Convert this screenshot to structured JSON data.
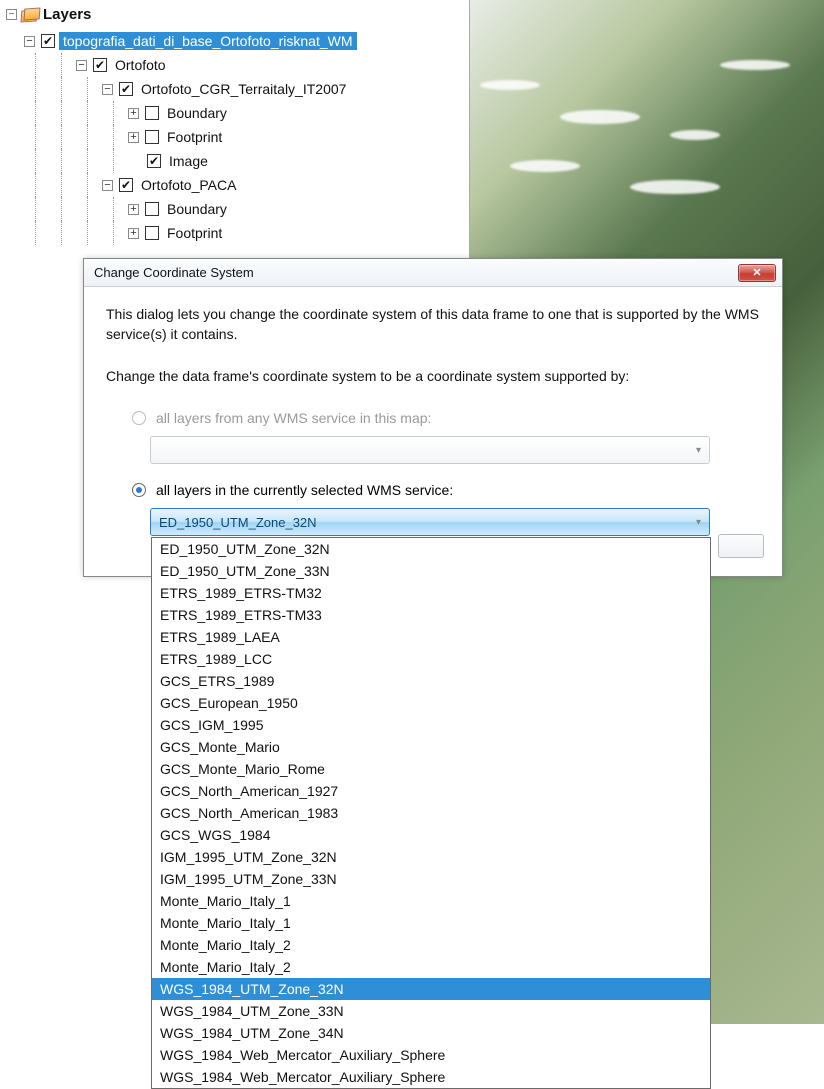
{
  "layers_panel": {
    "title": "Layers"
  },
  "tree": {
    "root": "topografia_dati_di_base_Ortofoto_risknat_WM",
    "ortofoto": "Ortofoto",
    "cgr": "Ortofoto_CGR_Terraitaly_IT2007",
    "boundary": "Boundary",
    "footprint": "Footprint",
    "image": "Image",
    "paca": "Ortofoto_PACA"
  },
  "dialog": {
    "title": "Change Coordinate System",
    "intro": "This dialog lets you change the coordinate system of this data frame to one that is supported by the WMS service(s) it contains.",
    "prompt": "Change the data frame's coordinate system to be a coordinate system supported by:",
    "opt_all_services": "all layers from any WMS service in this map:",
    "opt_selected_service": "all layers in the currently selected WMS service:",
    "combo_value": "ED_1950_UTM_Zone_32N"
  },
  "crs_options": [
    "ED_1950_UTM_Zone_32N",
    "ED_1950_UTM_Zone_33N",
    "ETRS_1989_ETRS-TM32",
    "ETRS_1989_ETRS-TM33",
    "ETRS_1989_LAEA",
    "ETRS_1989_LCC",
    "GCS_ETRS_1989",
    "GCS_European_1950",
    "GCS_IGM_1995",
    "GCS_Monte_Mario",
    "GCS_Monte_Mario_Rome",
    "GCS_North_American_1927",
    "GCS_North_American_1983",
    "GCS_WGS_1984",
    "IGM_1995_UTM_Zone_32N",
    "IGM_1995_UTM_Zone_33N",
    "Monte_Mario_Italy_1",
    "Monte_Mario_Italy_1",
    "Monte_Mario_Italy_2",
    "Monte_Mario_Italy_2",
    "WGS_1984_UTM_Zone_32N",
    "WGS_1984_UTM_Zone_33N",
    "WGS_1984_UTM_Zone_34N",
    "WGS_1984_Web_Mercator_Auxiliary_Sphere",
    "WGS_1984_Web_Mercator_Auxiliary_Sphere"
  ],
  "highlighted_index": 20
}
